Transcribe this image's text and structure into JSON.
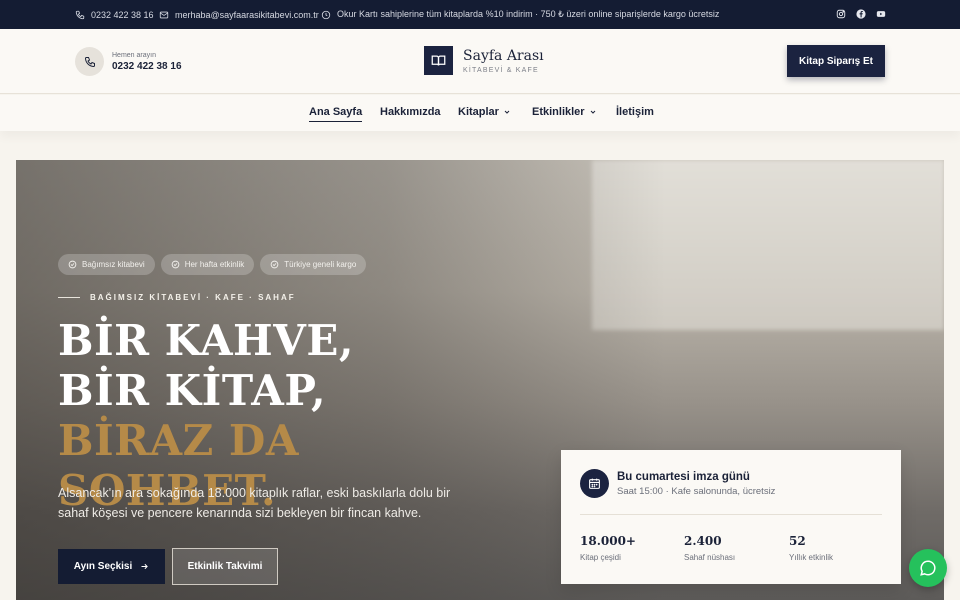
{
  "topbar": {
    "phone": "0232 422 38 16",
    "email": "merhaba@sayfaarasikitabevi.com.tr",
    "notice": "Okur Kartı sahiplerine tüm kitaplarda %10 indirim · 750 ₺ üzeri online siparişlerde kargo ücretsiz",
    "social": [
      "instagram-icon",
      "facebook-icon",
      "youtube-icon"
    ]
  },
  "header": {
    "call_label": "Hemen arayın",
    "call_number": "0232 422 38 16",
    "brand_name": "Sayfa Arası",
    "brand_sub": "KİTABEVİ & KAFE",
    "cta": "Kitap Siparış Et"
  },
  "nav": {
    "items": [
      {
        "label": "Ana Sayfa"
      },
      {
        "label": "Hakkımızda"
      },
      {
        "label": "Kitaplar"
      },
      {
        "label": "Etkinlikler"
      },
      {
        "label": "İletişim"
      }
    ]
  },
  "hero": {
    "chips": [
      "Bağımsız kitabevi",
      "Her hafta etkinlik",
      "Türkiye geneli kargo"
    ],
    "eyebrow": "BAĞIMSIZ KİTABEVİ · KAFE · SAHAF",
    "headline_white": "BİR KAHVE, BİR KİTAP, ",
    "headline_gold": "BİRAZ DA SOHBET.",
    "description": "Alsancak'ın ara sokağında 18.000 kitaplık raflar, eski baskılarla dolu bir sahaf köşesi ve pencere kenarında sizi bekleyen bir fincan kahve.",
    "primary_button": "Ayın Seçkisi",
    "secondary_button": "Etkinlik Takvimi"
  },
  "event_card": {
    "title": "Bu cumartesi imza günü",
    "subtitle": "Saat 15:00 · Kafe salonunda, ücretsiz",
    "stats": [
      {
        "value": "18.000+",
        "label": "Kitap çeşidi"
      },
      {
        "value": "2.400",
        "label": "Sahaf nüshası"
      },
      {
        "value": "52",
        "label": "Yıllık etkinlik"
      }
    ]
  },
  "colors": {
    "navy": "#141c33",
    "gold": "#b58a48",
    "cream": "#f7f4ee",
    "chat_green": "#25c15c"
  }
}
